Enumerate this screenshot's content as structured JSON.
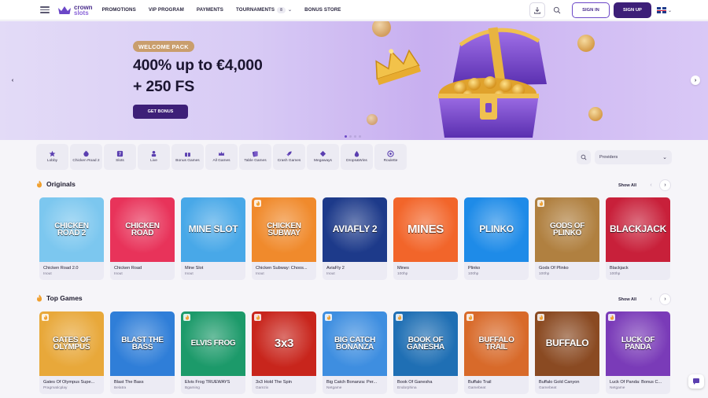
{
  "brand": {
    "line1": "crown",
    "line2": "slots"
  },
  "nav": [
    {
      "label": "PROMOTIONS"
    },
    {
      "label": "VIP PROGRAM"
    },
    {
      "label": "PAYMENTS"
    },
    {
      "label": "TOURNAMENTS",
      "badge": "8"
    },
    {
      "label": "BONUS STORE"
    }
  ],
  "header": {
    "signin": "SIGN IN",
    "signup": "SIGN UP",
    "language_flag": "uk-flag"
  },
  "banner": {
    "tag": "WELCOME PACK",
    "line1": "400% up to €4,000",
    "line2": "+ 250 FS",
    "cta": "GET BONUS",
    "slides": 4,
    "active_slide": 1
  },
  "categories": [
    {
      "label": "Lobby",
      "icon": "star-icon"
    },
    {
      "label": "Chicken Road 2",
      "icon": "chicken-icon"
    },
    {
      "label": "Slots",
      "icon": "slot-machine-icon"
    },
    {
      "label": "Live",
      "icon": "dealer-icon"
    },
    {
      "label": "Bonus Games",
      "icon": "gift-icon"
    },
    {
      "label": "All Games",
      "icon": "crown-icon"
    },
    {
      "label": "Table Games",
      "icon": "cards-icon"
    },
    {
      "label": "Crash Games",
      "icon": "rocket-icon"
    },
    {
      "label": "Megaways",
      "icon": "diamond-icon"
    },
    {
      "label": "Drops&Wins",
      "icon": "drops-icon"
    },
    {
      "label": "Roulette",
      "icon": "roulette-icon"
    }
  ],
  "providers_select": {
    "value": "Providers"
  },
  "sections": {
    "originals": {
      "title": "Originals",
      "show_all": "Show All",
      "games": [
        {
          "name": "Chicken Road 2.0",
          "provider": "Inout",
          "art": "CHICKEN ROAD 2",
          "bg": "#7cc7ef",
          "hot": false
        },
        {
          "name": "Chicken Road",
          "provider": "Inout",
          "art": "CHICKEN ROAD",
          "bg": "#e8335a",
          "hot": false
        },
        {
          "name": "Mine Slot",
          "provider": "Inout",
          "art": "MINE SLOT",
          "bg": "#48a8e8",
          "hot": false
        },
        {
          "name": "Chicken Subway: Choos...",
          "provider": "Inout",
          "art": "CHICKEN SUBWAY",
          "bg": "#f08a2c",
          "hot": true
        },
        {
          "name": "AviaFly 2",
          "provider": "Inout",
          "art": "AVIAFLY 2",
          "bg": "#1d3a8a",
          "hot": false
        },
        {
          "name": "Mines",
          "provider": "100hp",
          "art": "MINES",
          "bg": "#f2652a",
          "hot": false
        },
        {
          "name": "Plinko",
          "provider": "100hp",
          "art": "PLINKO",
          "bg": "#1e8be8",
          "hot": false
        },
        {
          "name": "Gods Of Plinko",
          "provider": "100hp",
          "art": "GODS OF PLINKO",
          "bg": "#b08040",
          "hot": true
        },
        {
          "name": "Blackjack",
          "provider": "100hp",
          "art": "BLACKJACK",
          "bg": "#c8203a",
          "hot": false
        }
      ]
    },
    "top": {
      "title": "Top Games",
      "show_all": "Show All",
      "games": [
        {
          "name": "Gates Of Olympus Supe...",
          "provider": "Pragmaticplay",
          "art": "GATES OF OLYMPUS",
          "bg": "#e8a83a",
          "hot": true
        },
        {
          "name": "Blast The Bass",
          "provider": "Belatra",
          "art": "BLAST THE BASS",
          "bg": "#2f7ed8",
          "hot": false
        },
        {
          "name": "Elvis Frog TRUEWAYS",
          "provider": "Bgaming",
          "art": "ELVIS FROG",
          "bg": "#1c9a6a",
          "hot": true
        },
        {
          "name": "3x3 Hold The Spin",
          "provider": "Gamzix",
          "art": "3x3",
          "bg": "#c8251c",
          "hot": true
        },
        {
          "name": "Big Catch Bonanza: Per...",
          "provider": "Netgame",
          "art": "BIG CATCH BONANZA",
          "bg": "#3e8ee0",
          "hot": true
        },
        {
          "name": "Book Of Ganesha",
          "provider": "Endorphina",
          "art": "BOOK OF GANESHA",
          "bg": "#1f6fb4",
          "hot": true
        },
        {
          "name": "Buffalo Trail",
          "provider": "Gamebeat",
          "art": "BUFFALO TRAIL",
          "bg": "#d86a2a",
          "hot": true
        },
        {
          "name": "Buffalo Gold Canyon",
          "provider": "Gamebeat",
          "art": "BUFFALO",
          "bg": "#8a4a22",
          "hot": true
        },
        {
          "name": "Luck Of Panda: Bonus C...",
          "provider": "Netgame",
          "art": "LUCK OF PANDA",
          "bg": "#7a3bb8",
          "hot": true
        }
      ]
    }
  },
  "colors": {
    "primary": "#3d1f78",
    "accent": "#6b47c7",
    "tag": "#c99e6d"
  }
}
